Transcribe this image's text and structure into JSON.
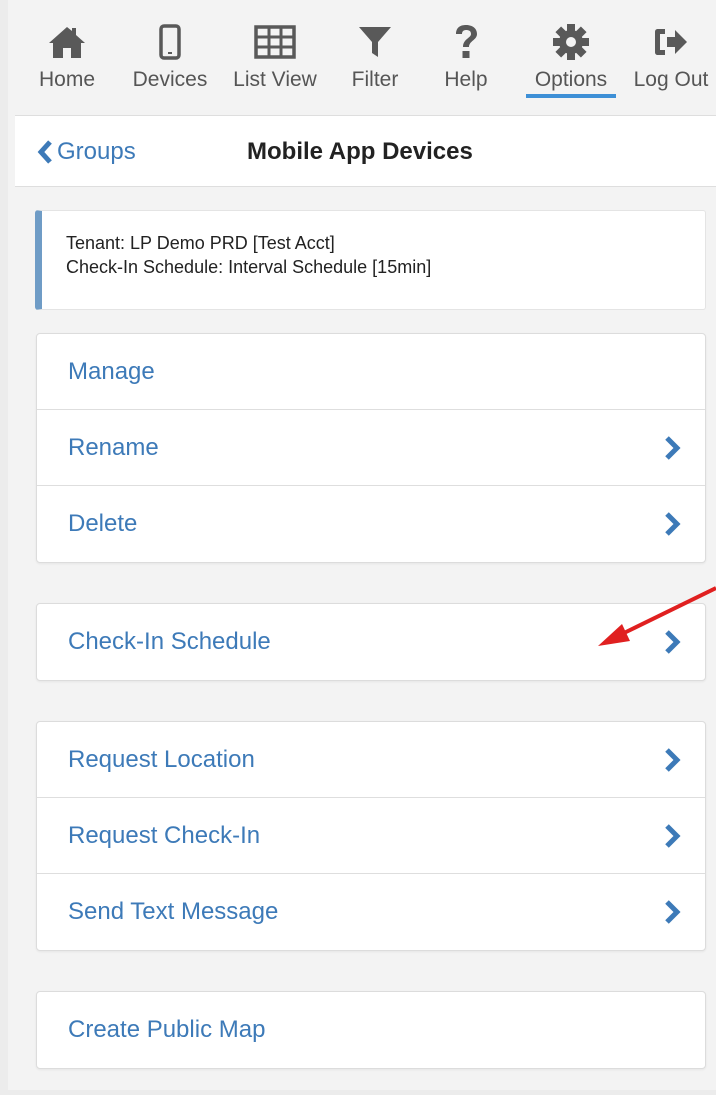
{
  "toolbar": {
    "items": [
      {
        "label": "Home",
        "icon": "home-icon"
      },
      {
        "label": "Devices",
        "icon": "phone-icon"
      },
      {
        "label": "List View",
        "icon": "table-icon"
      },
      {
        "label": "Filter",
        "icon": "filter-icon"
      },
      {
        "label": "Help",
        "icon": "question-icon"
      },
      {
        "label": "Options",
        "icon": "gear-icon",
        "active": true
      },
      {
        "label": "Log Out",
        "icon": "logout-icon"
      }
    ]
  },
  "header": {
    "back_label": "Groups",
    "title": "Mobile App Devices"
  },
  "info": {
    "tenant": "Tenant: LP Demo PRD [Test Acct]",
    "schedule": "Check-In Schedule: Interval Schedule [15min]"
  },
  "menu": {
    "manage": "Manage",
    "rename": "Rename",
    "delete": "Delete",
    "checkin_schedule": "Check-In Schedule",
    "request_location": "Request Location",
    "request_checkin": "Request Check-In",
    "send_text": "Send Text Message",
    "public_map": "Create Public Map"
  },
  "colors": {
    "link": "#3d7ab8",
    "accent_bar": "#6f9cc6",
    "active_underline": "#3d8fd6",
    "annotation_arrow": "#e02020"
  }
}
